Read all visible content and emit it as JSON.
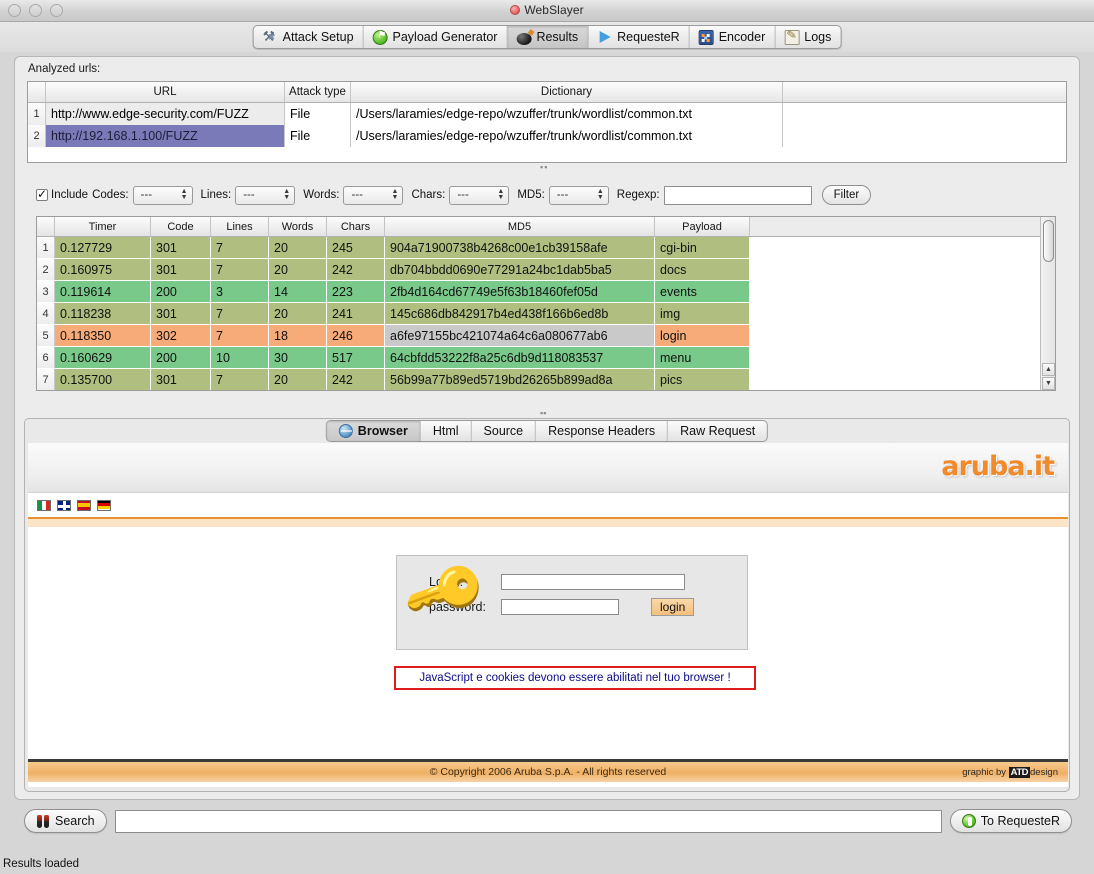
{
  "window": {
    "title": "WebSlayer",
    "controls": [
      "close",
      "minimize",
      "zoom"
    ]
  },
  "toolbar": {
    "tabs": [
      {
        "label": "Attack Setup",
        "icon": "wrench-icon",
        "selected": false
      },
      {
        "label": "Payload Generator",
        "icon": "green-ball-icon",
        "selected": false
      },
      {
        "label": "Results",
        "icon": "bomb-icon",
        "selected": true
      },
      {
        "label": "RequesteR",
        "icon": "blue-play-icon",
        "selected": false
      },
      {
        "label": "Encoder",
        "icon": "encoder-grid-icon",
        "selected": false
      },
      {
        "label": "Logs",
        "icon": "notepad-pencil-icon",
        "selected": false
      }
    ]
  },
  "urls_section": {
    "label": "Analyzed urls:",
    "columns": [
      "",
      "URL",
      "Attack type",
      "Dictionary"
    ],
    "rows": [
      {
        "num": "1",
        "url": "http://www.edge-security.com/FUZZ",
        "attack_type": "File",
        "dictionary": "/Users/laramies/edge-repo/wzuffer/trunk/wordlist/common.txt",
        "selected": false
      },
      {
        "num": "2",
        "url": "http://192.168.1.100/FUZZ",
        "attack_type": "File",
        "dictionary": "/Users/laramies/edge-repo/wzuffer/trunk/wordlist/common.txt",
        "selected": true
      }
    ]
  },
  "filter_bar": {
    "include_label": "Include",
    "include_checked": true,
    "fields": [
      {
        "label": "Codes:",
        "value": "---"
      },
      {
        "label": "Lines:",
        "value": "---"
      },
      {
        "label": "Words:",
        "value": "---"
      },
      {
        "label": "Chars:",
        "value": "---"
      },
      {
        "label": "MD5:",
        "value": "---"
      }
    ],
    "regexp_label": "Regexp:",
    "regexp_value": "",
    "filter_button": "Filter"
  },
  "results_table": {
    "columns": [
      "",
      "Timer",
      "Code",
      "Lines",
      "Words",
      "Chars",
      "MD5",
      "Payload"
    ],
    "colors": {
      "olive": "#b0bf7f",
      "green": "#79c98a",
      "orange": "#f7ab79",
      "selected_cell": "#c9c9c9"
    },
    "rows": [
      {
        "num": "1",
        "timer": "0.127729",
        "code": "301",
        "lines": "7",
        "words": "20",
        "chars": "245",
        "md5": "904a71900738b4268c00e1cb39158afe",
        "payload": "cgi-bin",
        "color": "olive"
      },
      {
        "num": "2",
        "timer": "0.160975",
        "code": "301",
        "lines": "7",
        "words": "20",
        "chars": "242",
        "md5": "db704bbdd0690e77291a24bc1dab5ba5",
        "payload": "docs",
        "color": "olive"
      },
      {
        "num": "3",
        "timer": "0.119614",
        "code": "200",
        "lines": "3",
        "words": "14",
        "chars": "223",
        "md5": "2fb4d164cd67749e5f63b18460fef05d",
        "payload": "events",
        "color": "green"
      },
      {
        "num": "4",
        "timer": "0.118238",
        "code": "301",
        "lines": "7",
        "words": "20",
        "chars": "241",
        "md5": "145c686db842917b4ed438f166b6ed8b",
        "payload": "img",
        "color": "olive"
      },
      {
        "num": "5",
        "timer": "0.118350",
        "code": "302",
        "lines": "7",
        "words": "18",
        "chars": "246",
        "md5": "a6fe97155bc421074a64c6a080677ab6",
        "payload": "login",
        "color": "orange",
        "md5_selected": true
      },
      {
        "num": "6",
        "timer": "0.160629",
        "code": "200",
        "lines": "10",
        "words": "30",
        "chars": "517",
        "md5": "64cbfdd53222f8a25c6db9d118083537",
        "payload": "menu",
        "color": "green"
      },
      {
        "num": "7",
        "timer": "0.135700",
        "code": "301",
        "lines": "7",
        "words": "20",
        "chars": "242",
        "md5": "56b99a77b89ed5719bd26265b899ad8a",
        "payload": "pics",
        "color": "olive"
      }
    ]
  },
  "browser_panel": {
    "tabs": [
      {
        "label": "Browser",
        "icon": "globe-icon",
        "selected": true
      },
      {
        "label": "Html",
        "selected": false
      },
      {
        "label": "Source",
        "selected": false
      },
      {
        "label": "Response Headers",
        "selected": false
      },
      {
        "label": "Raw Request",
        "selected": false
      }
    ],
    "page": {
      "logo_text": "aruba.it",
      "languages": [
        "italy-flag",
        "uk-flag",
        "spain-flag",
        "germany-flag"
      ],
      "login_form": {
        "login_label": "Login:",
        "login_value": "",
        "password_label": "password:",
        "password_value": "",
        "submit_label": "login"
      },
      "warning": "JavaScript e cookies devono essere abilitati nel tuo browser !",
      "footer_copyright": "© Copyright 2006 Aruba S.p.A. - All rights reserved",
      "footer_credit_prefix": "graphic by",
      "footer_credit_brand": "ATD",
      "footer_credit_suffix": "design"
    }
  },
  "bottom_bar": {
    "search_button": "Search",
    "search_value": "",
    "to_requester_button": "To RequesteR"
  },
  "status_bar": {
    "text": "Results loaded"
  }
}
